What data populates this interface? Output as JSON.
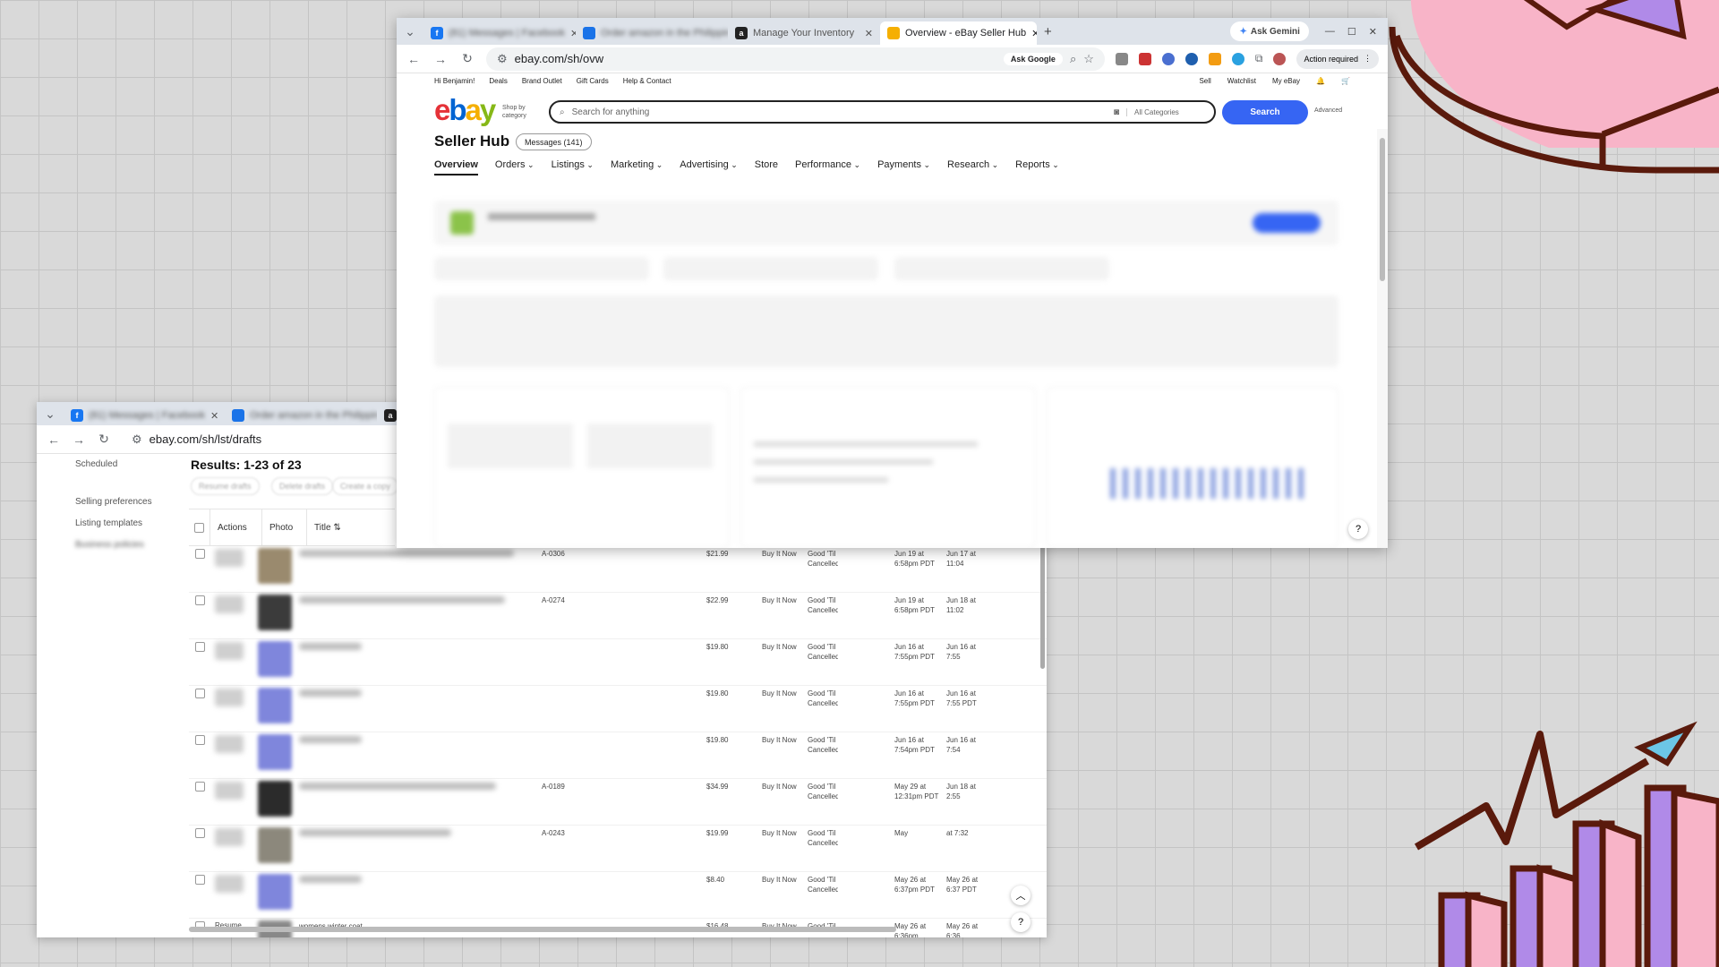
{
  "back_window": {
    "tabs": [
      {
        "label": "(81) Messages | Facebook",
        "favicon_color": "#1877f2"
      },
      {
        "label": "Order amazon in the Philippin",
        "favicon_color": "#1a73e8"
      },
      {
        "label": "a",
        "favicon_color": "#222"
      }
    ],
    "url": "ebay.com/sh/lst/drafts",
    "left_nav": [
      "Scheduled",
      "Selling preferences",
      "Listing templates",
      "Business policies"
    ],
    "results": "Results: 1-23 of 23",
    "actions": [
      "Resume drafts",
      "Delete drafts",
      "Create a copy"
    ],
    "columns": [
      "Actions",
      "Photo",
      "Title"
    ],
    "rows": [
      {
        "sku": "A-0306",
        "price": "$21.99",
        "format": "Buy It Now",
        "duration": "Good 'Til Cancelled",
        "start": "Jun 19 at 6:58pm PDT",
        "end": "Jun 17 at 11:04",
        "photo_color": "#9a8a6e"
      },
      {
        "sku": "A-0274",
        "price": "$22.99",
        "format": "Buy It Now",
        "duration": "Good 'Til Cancelled",
        "start": "Jun 19 at 6:58pm PDT",
        "end": "Jun 18 at 11:02",
        "photo_color": "#3b3b3b"
      },
      {
        "sku": "",
        "price": "$19.80",
        "format": "Buy It Now",
        "duration": "Good 'Til Cancelled",
        "start": "Jun 16 at 7:55pm PDT",
        "end": "Jun 16 at 7:55",
        "photo_color": "#7f86dc"
      },
      {
        "sku": "",
        "price": "$19.80",
        "format": "Buy It Now",
        "duration": "Good 'Til Cancelled",
        "start": "Jun 16 at 7:55pm PDT",
        "end": "Jun 16 at 7:55 PDT",
        "photo_color": "#7f86dc"
      },
      {
        "sku": "",
        "price": "$19.80",
        "format": "Buy It Now",
        "duration": "Good 'Til Cancelled",
        "start": "Jun 16 at 7:54pm PDT",
        "end": "Jun 16 at 7:54",
        "photo_color": "#7f86dc"
      },
      {
        "sku": "A-0189",
        "price": "$34.99",
        "format": "Buy It Now",
        "duration": "Good 'Til Cancelled",
        "start": "May 29 at 12:31pm PDT",
        "end": "Jun 18 at 2:55",
        "photo_color": "#2b2b2b"
      },
      {
        "sku": "A-0243",
        "price": "$19.99",
        "format": "Buy It Now",
        "duration": "Good 'Til Cancelled",
        "start": "May",
        "end": "at 7:32",
        "photo_color": "#8c887c"
      },
      {
        "sku": "",
        "price": "$8.40",
        "format": "Buy It Now",
        "duration": "Good 'Til Cancelled",
        "start": "May 26 at 6:37pm PDT",
        "end": "May 26 at 6:37 PDT",
        "photo_color": "#7f86dc"
      },
      {
        "sku": "",
        "price": "$16.48",
        "format": "Buy It Now",
        "duration": "Good 'Til",
        "start": "May 26 at 6:36pm",
        "end": "May 26 at 6:36",
        "photo_color": "#888"
      }
    ],
    "last_row_action": "Resume",
    "last_row_title": "womens winter coat"
  },
  "front_window": {
    "tabs": [
      {
        "label": "(81) Messages | Facebook",
        "favicon_color": "#1877f2"
      },
      {
        "label": "Order amazon in the Philippin",
        "favicon_color": "#1a73e8"
      },
      {
        "label": "Manage Your Inventory",
        "favicon_color": "#222"
      },
      {
        "label": "Overview - eBay Seller Hub",
        "favicon_color": "#f5af02"
      }
    ],
    "ask_gemini": "Ask Gemini",
    "url": "ebay.com/sh/ovw",
    "ask_google": "Ask Google",
    "action_required": "Action required",
    "topnav": [
      "Hi Benjamin!",
      "Deals",
      "Brand Outlet",
      "Gift Cards",
      "Help & Contact"
    ],
    "topnav_right": [
      "Sell",
      "Watchlist",
      "My eBay"
    ],
    "logo_letters": [
      "e",
      "b",
      "a",
      "y"
    ],
    "shop_by": "Shop by category",
    "search_placeholder": "Search for anything",
    "category": "All Categories",
    "search_btn": "Search",
    "advanced": "Advanced",
    "title": "Seller Hub",
    "messages": "Messages (141)",
    "menu": [
      "Overview",
      "Orders",
      "Listings",
      "Marketing",
      "Advertising",
      "Store",
      "Performance",
      "Payments",
      "Research",
      "Reports"
    ],
    "menu_dropdown": [
      false,
      true,
      true,
      true,
      true,
      false,
      true,
      true,
      true,
      true
    ]
  },
  "colors": {
    "ebay_red": "#e53238",
    "ebay_blue": "#0064d2",
    "ebay_yellow": "#f5af02",
    "ebay_green": "#86b817",
    "accent": "#3665f3",
    "deco_brown": "#5a1a0c",
    "deco_pink": "#f8b4c8",
    "deco_purple": "#b08ae8",
    "deco_cyan": "#6cc6e6"
  }
}
